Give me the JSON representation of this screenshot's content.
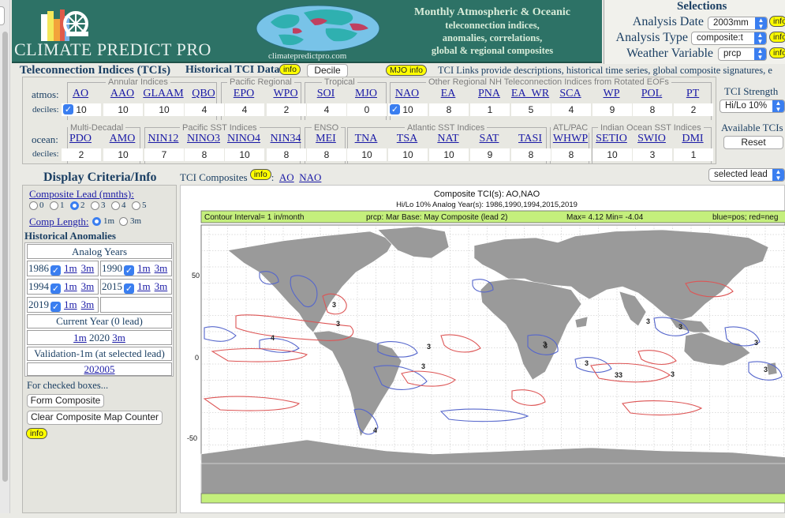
{
  "header": {
    "brand": "CLIMATE PREDICT PRO",
    "site_url": "climatepredictpro.com",
    "tagline_1": "Monthly Atmospheric & Oceanic",
    "tagline_2": "teleconnection indices,",
    "tagline_3": "anomalies, correlations,",
    "tagline_4": "global & regional composites"
  },
  "selections": {
    "title": "Selections",
    "analysis_date_label": "Analysis Date",
    "analysis_date_value": "2003mm",
    "analysis_type_label": "Analysis Type",
    "analysis_type_value": "composite:t",
    "weather_variable_label": "Weather Variable",
    "weather_variable_value": "prcp",
    "info": "info"
  },
  "tci": {
    "title": "Teleconnection Indices (TCIs)",
    "historical": "Historical TCI Data",
    "info": "info",
    "decile_button": "Decile",
    "mjo_info": "MJO info",
    "links_text": "TCI Links provide descriptions, historical time series, global composite signatures, e",
    "strength_label": "TCI Strength",
    "strength_value": "Hi/Lo 10%",
    "available_label": "Available TCIs",
    "reset_button": "Reset",
    "atmos_label": "atmos:",
    "ocean_label": "ocean:",
    "deciles_label": "deciles:",
    "atmos_groups": [
      "Annular Indices",
      "Pacific Regional",
      "Tropical",
      "Other Regional NH Teleconnection Indices from Rotated EOFs"
    ],
    "ocean_groups": [
      "Multi-Decadal",
      "Pacific SST Indices",
      "ENSO",
      "Atlantic SST Indices",
      "ATL/PAC",
      "Indian Ocean SST Indices"
    ],
    "atmos": [
      {
        "name": "AO",
        "decile": "10",
        "checked": true
      },
      {
        "name": "AAO",
        "decile": "10",
        "checked": false
      },
      {
        "name": "GLAAM",
        "decile": "10",
        "checked": false
      },
      {
        "name": "QBO",
        "decile": "4",
        "checked": false
      },
      {
        "name": "EPO",
        "decile": "4",
        "checked": false
      },
      {
        "name": "WPO",
        "decile": "2",
        "checked": false
      },
      {
        "name": "SOI",
        "decile": "4",
        "checked": false
      },
      {
        "name": "MJO",
        "decile": "0",
        "checked": false
      },
      {
        "name": "NAO",
        "decile": "10",
        "checked": true
      },
      {
        "name": "EA",
        "decile": "8",
        "checked": false
      },
      {
        "name": "PNA",
        "decile": "1",
        "checked": false
      },
      {
        "name": "EA_WR",
        "decile": "5",
        "checked": false
      },
      {
        "name": "SCA",
        "decile": "4",
        "checked": false
      },
      {
        "name": "WP",
        "decile": "9",
        "checked": false
      },
      {
        "name": "POL",
        "decile": "8",
        "checked": false
      },
      {
        "name": "PT",
        "decile": "2",
        "checked": false
      }
    ],
    "ocean": [
      {
        "name": "PDO",
        "decile": "2"
      },
      {
        "name": "AMO",
        "decile": "10"
      },
      {
        "name": "NIN12",
        "decile": "7"
      },
      {
        "name": "NINO3",
        "decile": "8"
      },
      {
        "name": "NINO4",
        "decile": "10"
      },
      {
        "name": "NIN34",
        "decile": "8"
      },
      {
        "name": "MEI",
        "decile": "8"
      },
      {
        "name": "TNA",
        "decile": "10"
      },
      {
        "name": "TSA",
        "decile": "10"
      },
      {
        "name": "NAT",
        "decile": "10"
      },
      {
        "name": "SAT",
        "decile": "9"
      },
      {
        "name": "TASI",
        "decile": "8"
      },
      {
        "name": "WHWP",
        "decile": "8"
      },
      {
        "name": "SETIO",
        "decile": "10"
      },
      {
        "name": "SWIO",
        "decile": "3"
      },
      {
        "name": "DMI",
        "decile": "1"
      }
    ]
  },
  "criteria": {
    "title": "Display Criteria/Info",
    "lead_label": "Composite Lead (mnths):",
    "leads": [
      "0",
      "1",
      "2",
      "3",
      "4",
      "5"
    ],
    "lead_selected": 2,
    "comp_length_label": "Comp Length:",
    "comp_length_1m": "1m",
    "comp_length_3m": "3m",
    "hist_anomalies": "Historical Anomalies",
    "analog_years_title": "Analog Years",
    "analog_years": [
      "1986",
      "1990",
      "1994",
      "2015",
      "2019"
    ],
    "one_month": "1m",
    "three_month": "3m",
    "current_year_label": "Current Year (0 lead)",
    "current_year": "2020",
    "validation_label": "Validation-1m (at selected lead)",
    "validation_value": "202005",
    "for_checked": "For checked boxes...",
    "form_composite": "Form Composite",
    "clear_counter": "Clear Composite Map Counter",
    "info": "info"
  },
  "composites": {
    "label": "TCI Composites",
    "info": "info",
    "links": [
      "AO",
      "NAO"
    ],
    "lead_select": "selected lead"
  },
  "map": {
    "title": "Composite TCI(s): AO,NAO",
    "subtitle": "Hi/Lo 10% Analog Year(s): 1986,1990,1994,2015,2019",
    "bar_left": "Contour Interval= 1 in/month",
    "bar_mid": "prcp:  Mar Base:  May Composite (lead 2)",
    "bar_max": "Max= 4.12  Min= -4.04",
    "bar_right": "blue=pos; red=neg",
    "lat_labels": [
      "50",
      "0",
      "-50"
    ],
    "contour_labels": [
      "3",
      "3",
      "4",
      "3",
      "3",
      "3",
      "3",
      "3",
      "3",
      "3",
      "3",
      "3",
      "3",
      "3",
      "4",
      "3"
    ],
    "colors": {
      "land": "#9a9a9a",
      "pos": "#5566cc",
      "neg": "#dd5555",
      "bar": "#c4ef7c"
    }
  }
}
